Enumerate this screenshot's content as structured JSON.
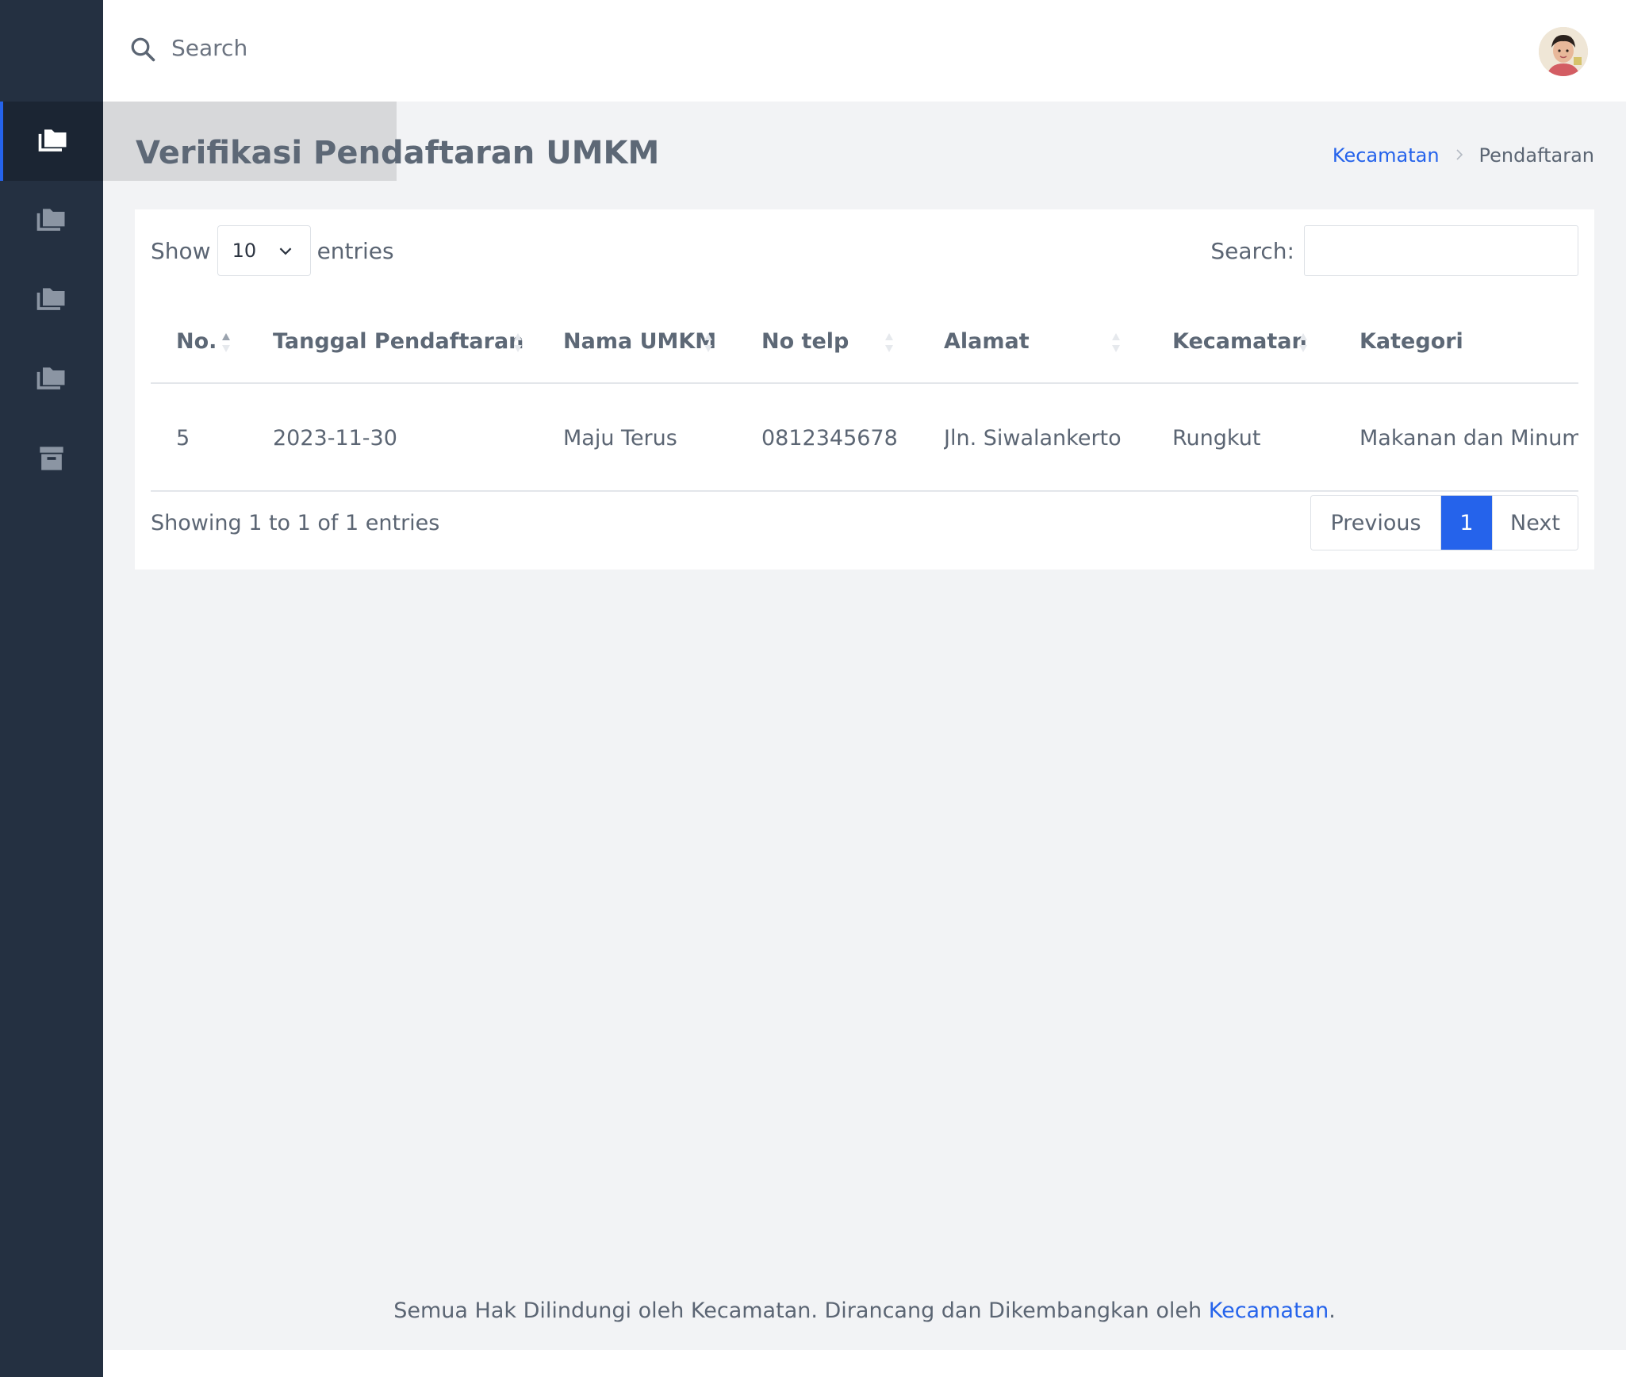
{
  "topbar": {
    "search_placeholder": "Search"
  },
  "sidebar": {
    "items": [
      {
        "icon": "folders-icon",
        "active": true
      },
      {
        "icon": "folders-icon",
        "active": false
      },
      {
        "icon": "folders-icon",
        "active": false
      },
      {
        "icon": "folders-icon",
        "active": false
      },
      {
        "icon": "archive-icon",
        "active": false
      }
    ]
  },
  "page": {
    "title": "Verifikasi Pendaftaran UMKM",
    "breadcrumb": {
      "link": "Kecamatan",
      "separator": ">",
      "current": "Pendaftaran"
    }
  },
  "table_controls": {
    "show_label": "Show",
    "length_value": "10",
    "entries_label": "entries",
    "search_label": "Search:",
    "search_value": ""
  },
  "table": {
    "columns": [
      "No.",
      "Tanggal Pendaftaran",
      "Nama UMKM",
      "No telp",
      "Alamat",
      "Kecamatan",
      "Kategori"
    ],
    "rows": [
      [
        "5",
        "2023-11-30",
        "Maju Terus",
        "0812345678",
        "Jln. Siwalankerto",
        "Rungkut",
        "Makanan dan Minuman"
      ]
    ]
  },
  "table_footer": {
    "info": "Showing 1 to 1 of 1 entries",
    "previous": "Previous",
    "current_page": "1",
    "next": "Next"
  },
  "footer": {
    "text": "Semua Hak Dilindungi oleh Kecamatan. Dirancang dan Dikembangkan oleh",
    "link": "Kecamatan",
    "end": "."
  },
  "colors": {
    "sidebar": "#243041",
    "accent": "#2563eb",
    "background": "#f2f3f5"
  }
}
